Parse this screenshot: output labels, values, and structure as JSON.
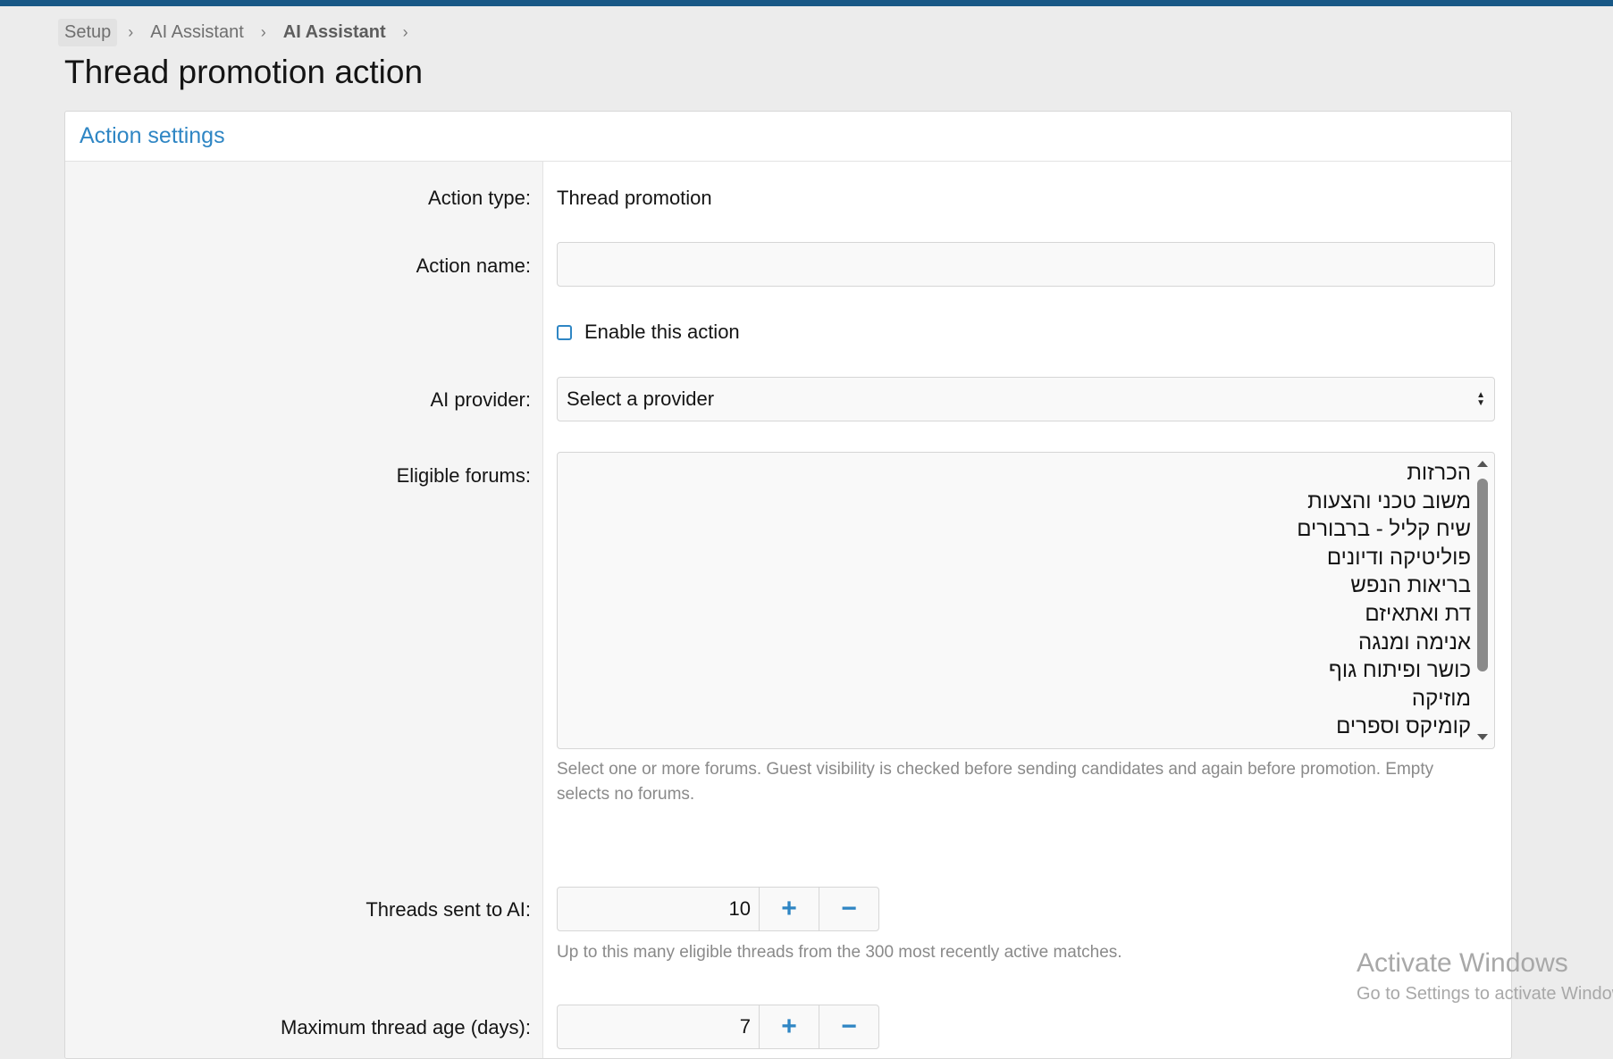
{
  "breadcrumb": [
    "Setup",
    "AI Assistant",
    "AI Assistant"
  ],
  "page_title": "Thread promotion action",
  "panel": {
    "title": "Action settings"
  },
  "form": {
    "action_type_label": "Action type:",
    "action_type_value": "Thread promotion",
    "action_name_label": "Action name:",
    "action_name_value": "",
    "enable_label": "Enable this action",
    "enable_checked": false,
    "ai_provider_label": "AI provider:",
    "ai_provider_value": "Select a provider",
    "eligible_forums_label": "Eligible forums:",
    "forums": [
      "הכרזות",
      "משוב טכני והצעות",
      "שיח קליל - ברבורים",
      "פוליטיקה ודיונים",
      "בריאות הנפש",
      "דת ואתאיזם",
      "אנימה ומנגה",
      "כושר ופיתוח גוף",
      "מוזיקה",
      "קומיקס וספרים"
    ],
    "forums_hint": "Select one or more forums. Guest visibility is checked before sending candidates and again before promotion. Empty selects no forums.",
    "threads_sent_label": "Threads sent to AI:",
    "threads_sent_value": "10",
    "threads_sent_hint": "Up to this many eligible threads from the 300 most recently active matches.",
    "max_age_label": "Maximum thread age (days):",
    "max_age_value": "7",
    "plus": "+",
    "minus": "−"
  },
  "watermark": {
    "title": "Activate Windows",
    "subtitle": "Go to Settings to activate Windows."
  },
  "colors": {
    "accent": "#2f86c4",
    "topbar": "#185886",
    "background": "#ececec"
  }
}
